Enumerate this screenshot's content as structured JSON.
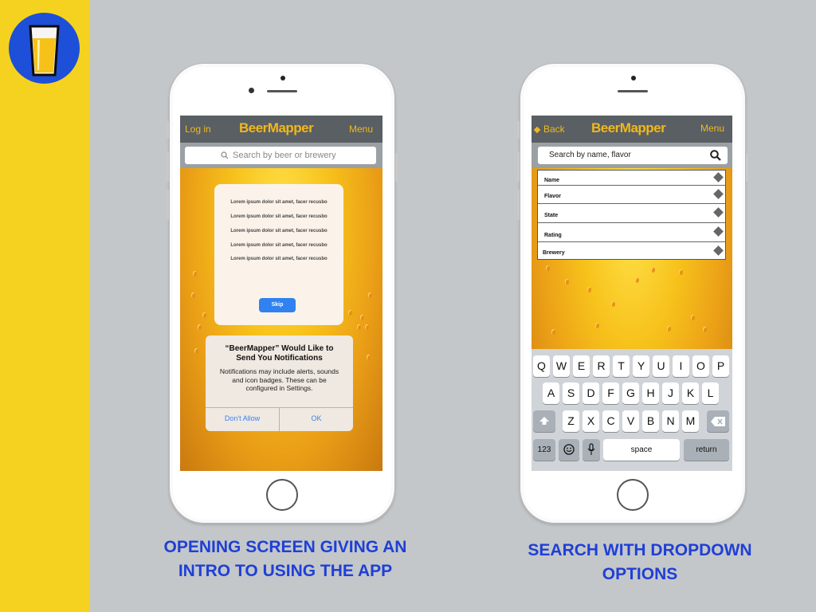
{
  "colors": {
    "accent": "#f2b81c",
    "caption": "#1f3fd6",
    "strip": "#f5d21f",
    "nav": "#595f63"
  },
  "logo": {
    "icon": "beer-glass-icon"
  },
  "left_phone": {
    "nav": {
      "left": "Log in",
      "brand": "BeerMapper",
      "right": "Menu"
    },
    "search": {
      "placeholder": "Search by beer or brewery",
      "icon": "search-icon"
    },
    "intro_card": {
      "lines": [
        "Lorem ipsum dolor sit amet, facer recusbo",
        "Lorem ipsum dolor sit amet, facer recusbo",
        "Lorem ipsum dolor sit amet, facer recusbo",
        "Lorem ipsum dolor sit amet, facer recusbo",
        "Lorem ipsum dolor sit amet, facer recusbo"
      ],
      "skip_label": "Skip"
    },
    "alert": {
      "title": "“BeerMapper” Would Like to Send You Notifications",
      "message": "Notifications may include alerts, sounds and icon badges. These can be configured in Settings.",
      "dont_allow": "Don't Allow",
      "ok": "OK"
    }
  },
  "right_phone": {
    "nav": {
      "left": "Back",
      "brand": "BeerMapper",
      "right": "Menu"
    },
    "search": {
      "placeholder": "Search by name, flavor",
      "icon": "search-icon"
    },
    "dropdown": [
      "Name",
      "Flavor",
      "State",
      "Rating",
      "Brewery"
    ],
    "keyboard": {
      "row1": [
        "Q",
        "W",
        "E",
        "R",
        "T",
        "Y",
        "U",
        "I",
        "O",
        "P"
      ],
      "row2": [
        "A",
        "S",
        "D",
        "F",
        "G",
        "H",
        "J",
        "K",
        "L"
      ],
      "row3": [
        "Z",
        "X",
        "C",
        "V",
        "B",
        "N",
        "M"
      ],
      "numbers": "123",
      "space": "space",
      "return": "return"
    }
  },
  "captions": {
    "left": [
      "OPENING SCREEN  GIVING  AN",
      "INTRO TO USING THE APP"
    ],
    "right": [
      "SEARCH WITH DROPDOWN",
      "OPTIONS"
    ]
  }
}
